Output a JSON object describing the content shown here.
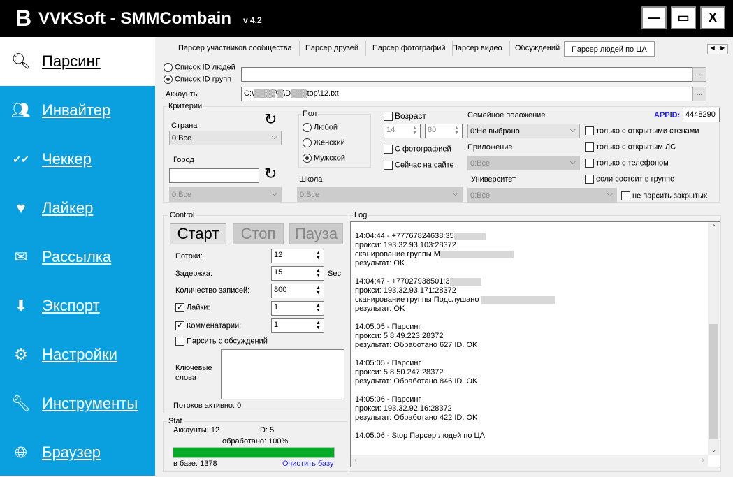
{
  "window": {
    "logo": "B",
    "title": "VVKSoft - SMMCombain",
    "version": "v 4.2",
    "minimize": "—",
    "maximize": "▭",
    "close": "X"
  },
  "sidebar": {
    "items": [
      {
        "label": "Парсинг",
        "icon": "search-icon",
        "active": true
      },
      {
        "label": "Инвайтер",
        "icon": "users-icon"
      },
      {
        "label": "Чеккер",
        "icon": "double-check-icon"
      },
      {
        "label": "Лайкер",
        "icon": "heart-icon"
      },
      {
        "label": "Рассылка",
        "icon": "mail-icon"
      },
      {
        "label": "Экспорт",
        "icon": "download-icon"
      },
      {
        "label": "Настройки",
        "icon": "gear-icon"
      },
      {
        "label": "Инструменты",
        "icon": "wrench-icon"
      },
      {
        "label": "Браузер",
        "icon": "globe-icon"
      }
    ]
  },
  "tabs": [
    "Парсер участников сообщества",
    "Парсер друзей",
    "Парсер фотографий",
    "Парсер видео",
    "Обсуждений",
    "Парсер людей по ЦА"
  ],
  "source": {
    "radio_people": "Список ID людей",
    "radio_groups": "Список ID групп",
    "selected": "groups",
    "list_value": "",
    "browse": "...",
    "accounts_label": "Аккаунты",
    "accounts_value": "C:\\▒▒▒▒\\▒\\D▒▒▒top\\12.txt"
  },
  "criteria": {
    "title": "Критерии",
    "country_label": "Страна",
    "country": "0:Все",
    "city_label": "Город",
    "city_value": "",
    "city_select": "0:Все",
    "gender_title": "Пол",
    "genders": [
      "Любой",
      "Женский",
      "Мужской"
    ],
    "gender_selected": 2,
    "age_label": "Возраст",
    "age_checked": false,
    "age_from": "14",
    "age_to": "80",
    "with_photo": "С фотографией",
    "online": "Сейчас на сайте",
    "school_label": "Школа",
    "school": "0:Все",
    "family_label": "Семейное положение",
    "family": "0:Не выбрано",
    "app_label": "Приложение",
    "app": "0:Все",
    "univ_label": "Университет",
    "univ": "0:Все",
    "appid_label": "APPID:",
    "appid": "4448290",
    "options": [
      "только с открытыми стенами",
      "только с открытым ЛС",
      "только с телефоном",
      "если состоит в группе"
    ],
    "no_closed": "не парсить закрытых"
  },
  "control": {
    "title": "Control",
    "start": "Старт",
    "stop": "Стоп",
    "pause": "Пауза",
    "threads_label": "Потоки:",
    "threads": "12",
    "delay_label": "Задержка:",
    "delay": "15",
    "delay_unit": "Sec",
    "records_label": "Количество записей:",
    "records": "800",
    "likes_label": "Лайки:",
    "likes": "1",
    "comments_label": "Комменатарии:",
    "comments": "1",
    "discussions_label": "Парсить с обсуждений",
    "keywords_label": "Ключевые слова",
    "keywords": "",
    "active_threads": "Потоков активно: 0"
  },
  "stat": {
    "title": "Stat",
    "accounts": "Аккаунты: 12",
    "id": "ID: 5",
    "processed": "обработано: 100%",
    "progress": 100,
    "progress_color": "#06ab28",
    "in_db": "в базе: 1378",
    "clear_db": "Очистить базу"
  },
  "log": {
    "title": "Log",
    "lines": [
      "14:04:44 - +77767824638:35",
      "прокси: 193.32.93.103:28372",
      "сканирование группы М",
      "результат: OK",
      "",
      "14:04:47 - +77027938501:3",
      "прокси: 193.32.93.171:28372",
      "сканирование группы Подслушано ",
      "результат: OK",
      "",
      "14:05:05 - Парсинг",
      "прокси: 5.8.49.223:28372",
      "результат: Обработано 627 ID. OK",
      "",
      "14:05:05 - Парсинг",
      "прокси: 5.8.50.247:28372",
      "результат: Обработано 846 ID. OK",
      "",
      "14:05:06 - Парсинг",
      "прокси: 193.32.92.16:28372",
      "результат: Обработано 422 ID. OK",
      "",
      "14:05:06 - Stop Парсер людей по ЦА"
    ]
  }
}
